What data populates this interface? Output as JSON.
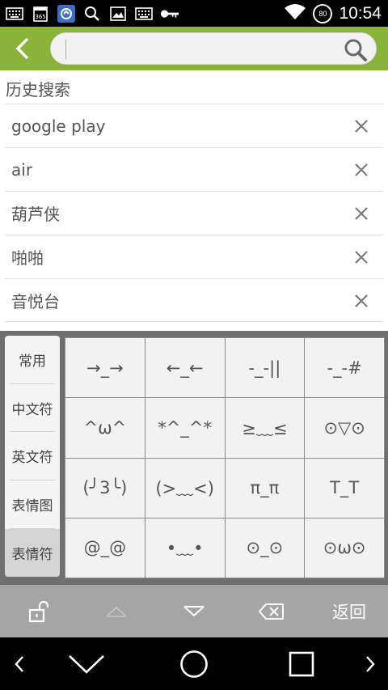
{
  "status_bar": {
    "time": "10:54",
    "battery": "80",
    "left_icons": [
      "keyboard-icon",
      "calendar-365-icon",
      "app-icon",
      "search-icon",
      "image-icon",
      "keyboard-icon",
      "key-icon"
    ],
    "right_icons": [
      "wifi-icon",
      "battery-icon"
    ]
  },
  "header": {
    "back_icon": "chevron-left-icon",
    "search": {
      "value": "",
      "placeholder": ""
    },
    "search_icon": "search-icon",
    "accent_color": "#8ab33b"
  },
  "history": {
    "title": "历史搜索",
    "items": [
      {
        "text": "google play"
      },
      {
        "text": "air"
      },
      {
        "text": "葫芦侠"
      },
      {
        "text": "啪啪"
      },
      {
        "text": "音悦台"
      }
    ]
  },
  "keyboard": {
    "tabs": [
      {
        "label": "常用"
      },
      {
        "label": "中文符"
      },
      {
        "label": "英文符"
      },
      {
        "label": "表情图"
      },
      {
        "label": "表情符"
      }
    ],
    "active_tab": "表情符",
    "keys": [
      "→_→",
      "←_←",
      "-_-||",
      "-_-#",
      "^ω^",
      "*^_^*",
      "≥﹏≤",
      "⊙▽⊙",
      "(╯3╰)",
      "(>﹏<)",
      "π_π",
      "T_T",
      "@_@",
      "•﹏•",
      "⊙_⊙",
      "⊙ω⊙"
    ],
    "toolbar": {
      "lock_icon": "unlock-icon",
      "up_icon": "triangle-up-icon",
      "down_icon": "triangle-down-icon",
      "backspace_icon": "backspace-icon",
      "return_label": "返回"
    }
  },
  "nav_bar": {
    "icons": [
      "chevron-left-icon",
      "chevron-down-icon",
      "circle-home-icon",
      "square-recents-icon",
      "chevron-right-icon"
    ]
  }
}
